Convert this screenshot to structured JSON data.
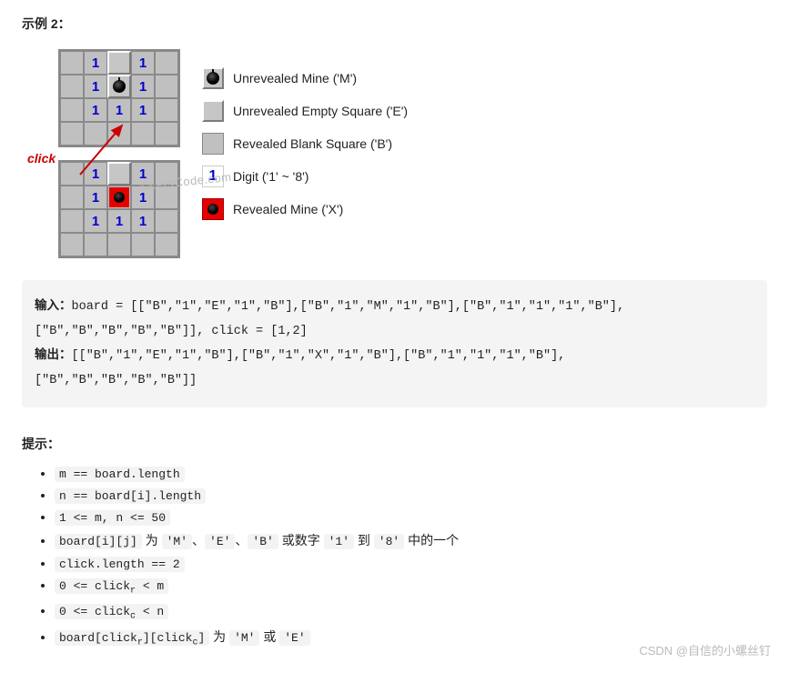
{
  "example_title": "示例 2：",
  "click_label": "click",
  "watermark": "©LeetCode.com",
  "board1": [
    [
      "B",
      "1",
      "E",
      "1",
      "B"
    ],
    [
      "B",
      "1",
      "M",
      "1",
      "B"
    ],
    [
      "B",
      "1",
      "1",
      "1",
      "B"
    ],
    [
      "B",
      "B",
      "B",
      "B",
      "B"
    ]
  ],
  "board2": [
    [
      "B",
      "1",
      "E",
      "1",
      "B"
    ],
    [
      "B",
      "1",
      "X",
      "1",
      "B"
    ],
    [
      "B",
      "1",
      "1",
      "1",
      "B"
    ],
    [
      "B",
      "B",
      "B",
      "B",
      "B"
    ]
  ],
  "legend": {
    "m": "Unrevealed Mine ('M')",
    "e": "Unrevealed Empty Square ('E')",
    "b": "Revealed Blank Square ('B')",
    "d": "Digit ('1' ~ '8')",
    "x": "Revealed Mine ('X')",
    "digit_sample": "1"
  },
  "io": {
    "input_label": "输入：",
    "input_text": "board = [[\"B\",\"1\",\"E\",\"1\",\"B\"],[\"B\",\"1\",\"M\",\"1\",\"B\"],[\"B\",\"1\",\"1\",\"1\",\"B\"],\n[\"B\",\"B\",\"B\",\"B\",\"B\"]], click = [1,2]",
    "output_label": "输出：",
    "output_text": "[[\"B\",\"1\",\"E\",\"1\",\"B\"],[\"B\",\"1\",\"X\",\"1\",\"B\"],[\"B\",\"1\",\"1\",\"1\",\"B\"],\n[\"B\",\"B\",\"B\",\"B\",\"B\"]]"
  },
  "hints_title": "提示：",
  "hints": {
    "h1": "m == board.length",
    "h2": "n == board[i].length",
    "h3": "1 <= m, n <= 50",
    "h4_a": "board[i][j]",
    "h4_b": " 为 ",
    "h4_c": "'M'",
    "h4_d": "、",
    "h4_e": "'E'",
    "h4_f": "、",
    "h4_g": "'B'",
    "h4_h": " 或数字 ",
    "h4_i": "'1'",
    "h4_j": " 到 ",
    "h4_k": "'8'",
    "h4_l": " 中的一个",
    "h5": "click.length == 2",
    "h6a": "0 <= click",
    "h6b": " < m",
    "h7a": "0 <= click",
    "h7b": " < n",
    "h8a": "board[click",
    "h8b": "][click",
    "h8c": "]",
    "h8d": " 为 ",
    "h8e": "'M'",
    "h8f": " 或 ",
    "h8g": "'E'",
    "sub_r": "r",
    "sub_c": "c"
  },
  "footer": "CSDN @自信的小螺丝钉"
}
